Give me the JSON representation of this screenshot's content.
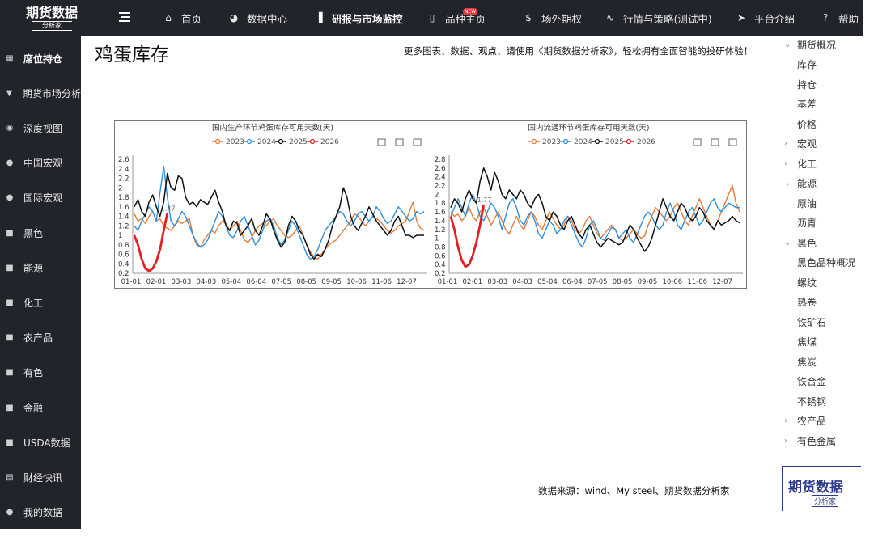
{
  "logo": {
    "main": "期货数据",
    "sub": "分析家"
  },
  "nav": [
    {
      "label": "首页",
      "icon": "home-icon",
      "glyph": "⌂"
    },
    {
      "label": "数据中心",
      "icon": "pie-chart-icon",
      "glyph": "◕"
    },
    {
      "label": "研报与市场监控",
      "icon": "bar-chart-icon",
      "glyph": "▐"
    },
    {
      "label": "品种主页",
      "icon": "book-icon",
      "glyph": "▯",
      "badge": "NEW"
    },
    {
      "label": "场外期权",
      "icon": "dollar-icon",
      "glyph": "$"
    },
    {
      "label": "行情与策略(测试中)",
      "icon": "pulse-icon",
      "glyph": "∿"
    },
    {
      "label": "平台介绍",
      "icon": "send-icon",
      "glyph": "➤"
    },
    {
      "label": "帮助",
      "icon": "help-icon",
      "glyph": "?"
    }
  ],
  "sidebar": [
    {
      "label": "席位持仓",
      "icon": "grid-icon",
      "glyph": "▦"
    },
    {
      "label": "期货市场分析",
      "icon": "filter-icon",
      "glyph": "▼"
    },
    {
      "label": "深度视图",
      "icon": "eye-icon",
      "glyph": "◉"
    },
    {
      "label": "中国宏观",
      "icon": "circle-icon",
      "glyph": "●"
    },
    {
      "label": "国际宏观",
      "icon": "circle-icon",
      "glyph": "●"
    },
    {
      "label": "黑色",
      "icon": "cube-icon",
      "glyph": "■"
    },
    {
      "label": "能源",
      "icon": "cube-icon",
      "glyph": "■"
    },
    {
      "label": "化工",
      "icon": "cube-icon",
      "glyph": "■"
    },
    {
      "label": "农产品",
      "icon": "cube-icon",
      "glyph": "■"
    },
    {
      "label": "有色",
      "icon": "cube-icon",
      "glyph": "■"
    },
    {
      "label": "金融",
      "icon": "cube-icon",
      "glyph": "■"
    },
    {
      "label": "USDA数据",
      "icon": "cube-icon",
      "glyph": "■"
    },
    {
      "label": "财经快讯",
      "icon": "document-icon",
      "glyph": "▤"
    },
    {
      "label": "我的数据",
      "icon": "circle-icon",
      "glyph": "●"
    }
  ],
  "page": {
    "title": "鸡蛋库存",
    "promo": "更多图表、数据、观点、请使用《期货数据分析家》，轻松拥有全面智能的投研体验！",
    "source": "数据来源：wind、My steel、期货数据分析家"
  },
  "tree": [
    {
      "label": "期货概况",
      "level": 0,
      "chevron": "⌄"
    },
    {
      "label": "库存",
      "level": 1
    },
    {
      "label": "持仓",
      "level": 1
    },
    {
      "label": "基差",
      "level": 1
    },
    {
      "label": "价格",
      "level": 1
    },
    {
      "label": "宏观",
      "level": 0,
      "chevron": "›"
    },
    {
      "label": "化工",
      "level": 0,
      "chevron": "›"
    },
    {
      "label": "能源",
      "level": 0,
      "chevron": "⌄"
    },
    {
      "label": "原油",
      "level": 1
    },
    {
      "label": "沥青",
      "level": 1
    },
    {
      "label": "黑色",
      "level": 0,
      "chevron": "⌄"
    },
    {
      "label": "黑色品种概况",
      "level": 1
    },
    {
      "label": "螺纹",
      "level": 1
    },
    {
      "label": "热卷",
      "level": 1
    },
    {
      "label": "铁矿石",
      "level": 1
    },
    {
      "label": "焦煤",
      "level": 1
    },
    {
      "label": "焦炭",
      "level": 1
    },
    {
      "label": "铁合金",
      "level": 1
    },
    {
      "label": "不锈钢",
      "level": 1
    },
    {
      "label": "农产品",
      "level": 0,
      "chevron": "›"
    },
    {
      "label": "有色金属",
      "level": 0,
      "chevron": "›"
    }
  ],
  "brand": {
    "main": "期货数据",
    "sub": "分析家"
  },
  "colors": {
    "2023": "#e07b39",
    "2024": "#2f8fdc",
    "2025": "#111111",
    "2026": "#e02020",
    "dark": "#22242b"
  },
  "chart_data": [
    {
      "type": "line",
      "title": "国内生产环节鸡蛋库存可用天数(天)",
      "x_ticks": [
        "01-01",
        "02-01",
        "03-03",
        "04-03",
        "05-04",
        "06-04",
        "07-05",
        "08-05",
        "09-05",
        "10-06",
        "11-06",
        "12-07"
      ],
      "y_ticks": [
        "0.2",
        "0.4",
        "0.6",
        "0.8",
        "1",
        "1.2",
        "1.4",
        "1.6",
        "1.8",
        "2",
        "2.2",
        "2.4",
        "2.6"
      ],
      "ylim": [
        0.2,
        2.6
      ],
      "annotation": "1.47",
      "toolbox": [
        "restore-icon",
        "data-view-icon",
        "fullscreen-icon"
      ],
      "series": [
        {
          "name": "2023",
          "values": [
            1.45,
            1.3,
            1.35,
            1.25,
            1.4,
            1.5,
            1.3,
            1.35,
            1.2,
            1.15,
            1.1,
            1.2,
            1.3,
            1.25,
            1.3,
            1.35,
            1.0,
            0.8,
            0.75,
            0.9,
            1.0,
            1.1,
            1.05,
            1.2,
            1.3,
            1.25,
            1.1,
            1.2,
            1.3,
            1.1,
            0.9,
            0.85,
            0.95,
            1.1,
            1.2,
            1.25,
            1.2,
            1.3,
            1.35,
            1.2,
            1.1,
            1.0,
            0.95,
            1.0,
            1.1,
            1.2,
            1.0,
            0.8,
            0.65,
            0.55,
            0.5,
            0.6,
            0.7,
            0.8,
            0.85,
            0.9,
            1.0,
            1.1,
            1.2,
            1.3,
            1.45,
            1.4,
            1.3,
            1.2,
            1.3,
            1.4,
            1.35,
            1.3,
            1.2,
            1.1,
            1.05,
            1.1,
            1.2,
            1.25,
            1.3,
            1.5,
            1.7,
            1.3,
            1.15,
            1.1
          ]
        },
        {
          "name": "2024",
          "values": [
            1.2,
            1.1,
            1.3,
            1.45,
            1.6,
            1.5,
            1.3,
            1.9,
            2.45,
            1.8,
            1.3,
            1.2,
            1.35,
            1.5,
            1.4,
            1.2,
            1.0,
            0.85,
            0.75,
            0.8,
            0.9,
            1.1,
            1.3,
            1.5,
            1.4,
            1.2,
            1.0,
            0.95,
            1.1,
            1.3,
            1.4,
            1.2,
            1.0,
            0.8,
            0.9,
            1.1,
            1.3,
            1.35,
            1.2,
            0.95,
            0.8,
            0.9,
            1.1,
            1.3,
            1.2,
            1.0,
            0.8,
            0.6,
            0.5,
            0.55,
            0.7,
            0.9,
            1.1,
            1.2,
            1.3,
            1.4,
            1.5,
            1.45,
            1.3,
            1.2,
            1.3,
            1.45,
            1.5,
            1.4,
            1.3,
            1.4,
            1.6,
            1.5,
            1.35,
            1.25,
            1.3,
            1.45,
            1.6,
            1.5,
            1.4,
            1.3,
            1.35,
            1.5,
            1.45,
            1.5
          ]
        },
        {
          "name": "2025",
          "values": [
            1.6,
            1.75,
            1.5,
            1.4,
            1.7,
            1.85,
            1.6,
            1.4,
            1.7,
            2.3,
            2.0,
            1.95,
            2.25,
            2.2,
            1.8,
            1.65,
            1.7,
            1.6,
            1.75,
            1.7,
            1.65,
            1.8,
            1.95,
            1.7,
            1.5,
            1.2,
            1.1,
            1.3,
            1.25,
            1.0,
            1.1,
            1.2,
            1.35,
            1.1,
            1.0,
            1.2,
            1.45,
            1.35,
            1.1,
            0.9,
            0.75,
            0.85,
            1.2,
            1.4,
            1.3,
            1.1,
            1.0,
            0.8,
            0.6,
            0.5,
            0.6,
            0.55,
            0.7,
            0.9,
            1.2,
            1.4,
            1.6,
            2.0,
            1.8,
            1.4,
            1.2,
            1.1,
            1.25,
            1.4,
            1.6,
            1.45,
            1.3,
            1.2,
            1.1,
            1.0,
            1.1,
            1.3,
            1.4,
            1.2,
            1.0,
            1.0,
            0.95,
            1.0,
            1.0,
            1.0
          ]
        },
        {
          "name": "2026",
          "values": [
            1.0,
            0.8,
            0.5,
            0.3,
            0.25,
            0.3,
            0.45,
            0.7,
            1.1,
            1.47
          ]
        }
      ]
    },
    {
      "type": "line",
      "title": "国内流通环节鸡蛋库存可用天数(天)",
      "x_ticks": [
        "01-01",
        "02-01",
        "03-03",
        "04-03",
        "05-04",
        "06-04",
        "07-05",
        "08-05",
        "09-05",
        "10-06",
        "11-06",
        "12-07"
      ],
      "y_ticks": [
        "0.2",
        "0.4",
        "0.6",
        "0.8",
        "1",
        "1.2",
        "1.4",
        "1.6",
        "1.8",
        "2",
        "2.2",
        "2.4",
        "2.6",
        "2.8"
      ],
      "ylim": [
        0.2,
        2.8
      ],
      "annotation": "1.77",
      "toolbox": [
        "restore-icon",
        "data-view-icon",
        "fullscreen-icon"
      ],
      "series": [
        {
          "name": "2023",
          "values": [
            1.6,
            1.5,
            1.55,
            1.4,
            1.5,
            1.7,
            1.5,
            1.4,
            1.6,
            1.7,
            1.5,
            1.3,
            1.45,
            1.6,
            1.4,
            1.2,
            1.1,
            1.3,
            1.5,
            1.3,
            1.2,
            1.4,
            1.6,
            1.5,
            1.3,
            1.2,
            1.4,
            1.6,
            1.45,
            1.3,
            1.2,
            1.3,
            1.5,
            1.4,
            1.2,
            1.1,
            1.2,
            1.4,
            1.5,
            1.3,
            1.1,
            1.0,
            1.1,
            1.2,
            1.3,
            1.2,
            1.0,
            0.95,
            1.0,
            1.1,
            1.2,
            1.1,
            1.0,
            1.05,
            1.3,
            1.5,
            1.7,
            1.6,
            1.5,
            1.4,
            1.5,
            1.7,
            1.8,
            1.6,
            1.4,
            1.3,
            1.5,
            1.7,
            1.9,
            1.7,
            1.5,
            1.3,
            1.2,
            1.4,
            1.6,
            1.8,
            2.0,
            2.2,
            1.8,
            1.6
          ]
        },
        {
          "name": "2024",
          "values": [
            1.5,
            1.7,
            1.9,
            1.7,
            1.5,
            1.8,
            2.0,
            1.8,
            1.5,
            1.4,
            1.6,
            1.8,
            1.7,
            1.5,
            1.2,
            1.5,
            1.8,
            1.9,
            1.7,
            1.4,
            1.3,
            1.5,
            1.6,
            1.4,
            1.1,
            1.0,
            1.2,
            1.4,
            1.3,
            1.1,
            1.2,
            1.4,
            1.5,
            1.3,
            1.1,
            0.9,
            0.8,
            1.0,
            1.3,
            1.4,
            1.2,
            1.0,
            0.95,
            1.1,
            1.25,
            1.2,
            1.0,
            1.1,
            1.2,
            1.0,
            0.9,
            1.1,
            1.3,
            1.5,
            1.6,
            1.5,
            1.3,
            1.2,
            1.3,
            1.6,
            1.8,
            1.6,
            1.3,
            1.2,
            1.4,
            1.6,
            1.7,
            1.5,
            1.3,
            1.4,
            1.6,
            1.8,
            1.9,
            1.7,
            1.6,
            1.7,
            1.8,
            1.75,
            1.7,
            1.7
          ]
        },
        {
          "name": "2025",
          "values": [
            1.7,
            1.9,
            1.8,
            1.6,
            1.9,
            2.1,
            1.9,
            1.8,
            2.3,
            2.6,
            2.4,
            2.1,
            2.5,
            2.3,
            2.0,
            1.9,
            2.1,
            2.0,
            1.9,
            2.1,
            2.0,
            1.8,
            1.7,
            1.9,
            2.0,
            1.8,
            1.5,
            1.4,
            1.6,
            1.5,
            1.3,
            1.2,
            1.4,
            1.5,
            1.3,
            1.1,
            1.0,
            1.2,
            1.3,
            1.1,
            0.9,
            0.8,
            0.9,
            1.0,
            0.95,
            0.9,
            0.85,
            0.9,
            1.1,
            1.3,
            1.2,
            1.0,
            0.85,
            0.7,
            0.8,
            1.0,
            1.3,
            1.6,
            1.9,
            1.7,
            1.5,
            1.4,
            1.6,
            1.8,
            1.7,
            1.5,
            1.4,
            1.5,
            1.7,
            1.6,
            1.4,
            1.3,
            1.2,
            1.4,
            1.3,
            1.35,
            1.4,
            1.5,
            1.4,
            1.35
          ]
        },
        {
          "name": "2026",
          "values": [
            1.5,
            1.2,
            0.8,
            0.5,
            0.35,
            0.4,
            0.6,
            0.9,
            1.3,
            1.77
          ]
        }
      ]
    }
  ]
}
